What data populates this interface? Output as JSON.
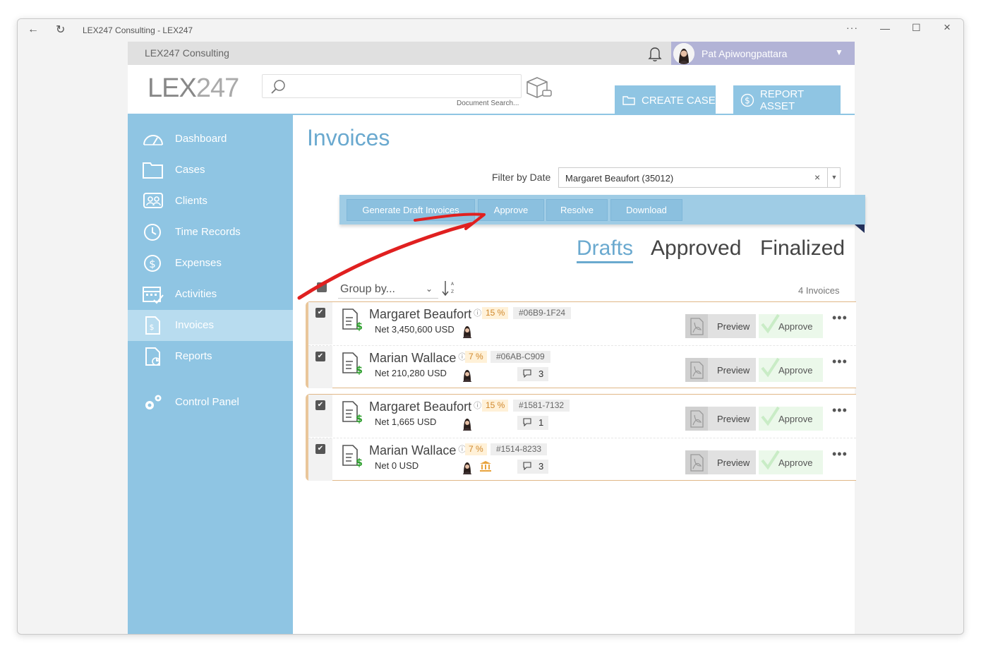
{
  "window": {
    "title": "LEX247 Consulting - LEX247"
  },
  "app": {
    "company": "LEX247 Consulting",
    "user_name": "Pat Apiwongpattara",
    "logo_bold": "LEX",
    "logo_light": "247",
    "search_caption": "Document Search...",
    "create_case_label": "CREATE CASE",
    "report_asset_label": "REPORT ASSET"
  },
  "sidebar": {
    "items": [
      {
        "label": "Dashboard",
        "icon": "gauge-icon"
      },
      {
        "label": "Cases",
        "icon": "folder-icon"
      },
      {
        "label": "Clients",
        "icon": "contacts-icon"
      },
      {
        "label": "Time Records",
        "icon": "clock-icon"
      },
      {
        "label": "Expenses",
        "icon": "dollar-circle-icon"
      },
      {
        "label": "Activities",
        "icon": "calendar-check-icon"
      },
      {
        "label": "Invoices",
        "icon": "invoice-icon",
        "active": true
      },
      {
        "label": "Reports",
        "icon": "report-icon"
      },
      {
        "label": "Control Panel",
        "icon": "gears-icon"
      }
    ]
  },
  "main": {
    "title": "Invoices",
    "filter_label": "Filter by Date",
    "filter_value": "Margaret Beaufort (35012)",
    "toolbar": {
      "generate": "Generate Draft Invoices",
      "approve": "Approve",
      "resolve": "Resolve",
      "download": "Download"
    },
    "tabs": {
      "drafts": "Drafts",
      "approved": "Approved",
      "finalized": "Finalized"
    },
    "group_by": "Group by...",
    "count": "4 Invoices",
    "row_labels": {
      "preview": "Preview",
      "approve": "Approve"
    },
    "invoices": [
      {
        "client": "Margaret Beaufort",
        "pct": "15 %",
        "ref": "#06B9-1F24",
        "net": "Net 3,450,600 USD",
        "comments": ""
      },
      {
        "client": "Marian Wallace",
        "pct": "7 %",
        "ref": "#06AB-C909",
        "net": "Net 210,280 USD",
        "comments": "3"
      },
      {
        "client": "Margaret Beaufort",
        "pct": "15 %",
        "ref": "#1581-7132",
        "net": "Net 1,665 USD",
        "comments": "1"
      },
      {
        "client": "Marian Wallace",
        "pct": "7 %",
        "ref": "#1514-8233",
        "net": "Net 0 USD",
        "comments": "3"
      }
    ]
  },
  "colors": {
    "accent": "#8fc5e3",
    "title_blue": "#6aa9cf",
    "annotation_red": "#e02020"
  }
}
